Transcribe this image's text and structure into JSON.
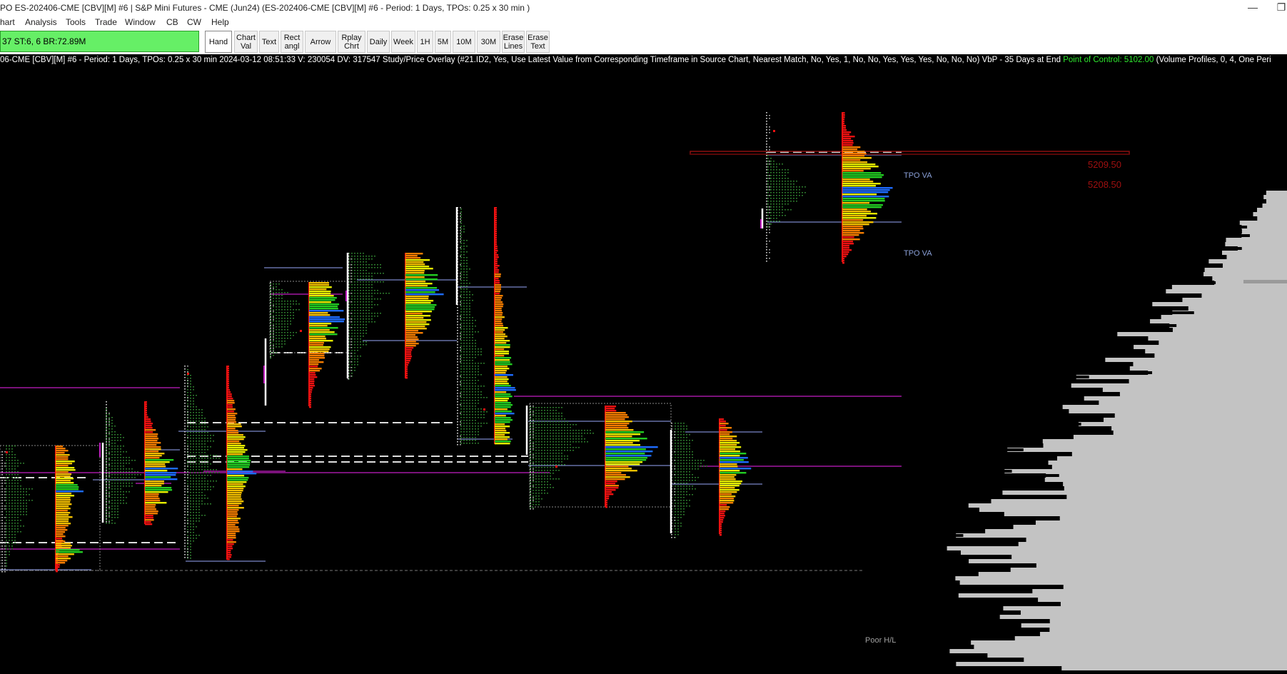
{
  "window": {
    "title": "PO ES-202406-CME [CBV][M] #6 | S&P Mini Futures - CME (Jun24) (ES-202406-CME [CBV][M] #6 - Period: 1 Days, TPOs: 0.25 x 30 min  )",
    "minimize_glyph": "—",
    "restore_glyph": "❐"
  },
  "menu": [
    "hart",
    "Analysis",
    "Tools",
    "Trade",
    "Window",
    "CB",
    "CW",
    "Help"
  ],
  "toolbar": {
    "status_text": "37  ST:6, 6  BR:72.89M",
    "buttons": [
      {
        "label": "Hand",
        "selected": true
      },
      {
        "label": "Chart\nVal"
      },
      {
        "label": "Text"
      },
      {
        "label": "Rect\nangl"
      },
      {
        "label": "Arrow"
      },
      {
        "label": "Rplay\nChrt"
      },
      {
        "label": "Daily"
      },
      {
        "label": "Week"
      },
      {
        "label": "1H"
      },
      {
        "label": "5M"
      },
      {
        "label": "10M"
      },
      {
        "label": "30M"
      },
      {
        "label": "Erase\nLines"
      },
      {
        "label": "Erase\nText"
      }
    ]
  },
  "info_line": {
    "main": "06-CME [CBV][M] #6 - Period: 1 Days, TPOs: 0.25 x 30 min   2024-03-12 08:51:33 V: 230054 DV: 317547 Study/Price Overlay   (#21.ID2, Yes, Use Latest Value from Corresponding Timeframe in Source Chart, Nearest Match, No, Yes, 1, No, No, Yes, Yes, Yes, No, No, No)  VbP - 35 Days at End  ",
    "poc": "Point of Control: 5102.00",
    "tail": "  (Volume Profiles, 0, 4, One Peri"
  },
  "chart": {
    "labels": {
      "tpo_va_upper": "TPO VA",
      "tpo_va_lower": "TPO VA",
      "price_high": "5209.50",
      "price_low": "5208.50",
      "poor_hl": "Poor H/L"
    },
    "colors": {
      "background": "#000000",
      "magenta_line": "#c21ec2",
      "value_area_line": "#7a86c8",
      "price_label": "#b01010",
      "volume_profile": "#c3c3c3",
      "status_green": "#66ef66"
    }
  }
}
